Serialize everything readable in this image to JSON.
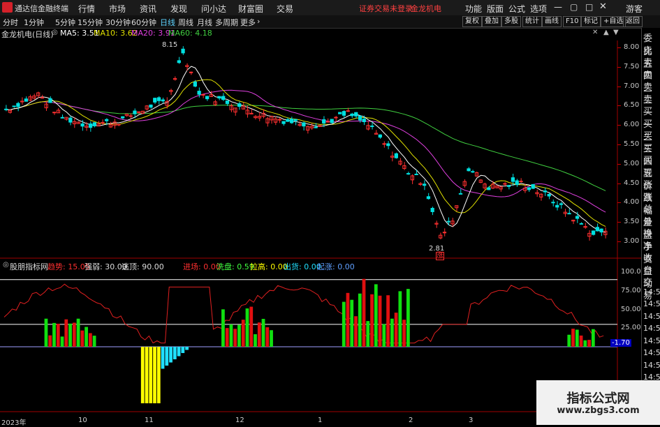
{
  "menubar": {
    "app_name": "通达信金融终端",
    "items": [
      "行情",
      "市场",
      "资讯",
      "发现",
      "问小达",
      "财富圈",
      "交易"
    ],
    "warning": "证券交易未登录",
    "stock": "金龙机电",
    "right_items": [
      "功能",
      "版面",
      "公式",
      "选项"
    ],
    "guest": "游客"
  },
  "toolbar": {
    "periods": [
      "分时",
      "1分钟",
      "5分钟",
      "15分钟",
      "30分钟",
      "60分钟",
      "日线",
      "周线",
      "月线",
      "多周期",
      "更多"
    ],
    "active": "日线",
    "right_buttons": [
      "复权",
      "叠加",
      "多股",
      "统计",
      "画线",
      "F10",
      "标记",
      "+自选",
      "返回"
    ]
  },
  "main_info": {
    "title": "金龙机电(日线)",
    "ma5": "MA5: 3.51",
    "ma10": "MA10: 3.62",
    "ma20": "MA20: 3.91",
    "ma60": "MA60: 4.18",
    "high_label": "8.15",
    "low_label": "2.81",
    "zhang": "涨"
  },
  "price_axis": [
    "8.00",
    "7.50",
    "7.00",
    "6.50",
    "6.00",
    "5.50",
    "5.00",
    "4.50",
    "4.00",
    "3.50",
    "3.00"
  ],
  "indicator": {
    "name": "股朋指标网",
    "trend": "趋势: 15.05",
    "strength": "强弱: 30.00",
    "escape": "逃顶: 90.00",
    "enter": "进场: 0.00",
    "wash": "洗盘: 0.59",
    "pull": "拉高: 0.00",
    "out": "出货: 0.00",
    "rise": "起涨: 0.00",
    "axis": [
      "100.0",
      "75.00",
      "50.00",
      "25.00"
    ],
    "current": "-1.70"
  },
  "right_panel": [
    "委比",
    "卖五",
    "卖四",
    "卖三",
    "卖二",
    "卖一",
    "买一",
    "买二",
    "买三",
    "买四",
    "买五",
    "现价",
    "涨跌",
    "涨幅",
    "总量",
    "外盘",
    "换手",
    "净资",
    "收益",
    "自动",
    "交易",
    "14:56",
    "14:56",
    "14:56",
    "14:56",
    "14:56",
    "14:56",
    "14:56",
    "14:56"
  ],
  "x_axis": [
    "2023年",
    "10",
    "11",
    "12",
    "1",
    "2",
    "3"
  ],
  "watermark": {
    "line1": "指标公式网",
    "line2": "www.zbgs3.com"
  },
  "colors": {
    "up": "#ff3030",
    "down": "#00e0e0",
    "ma5": "#ffffff",
    "ma10": "#e0e000",
    "ma20": "#e040e0",
    "ma60": "#40d040",
    "bar_red": "#e01010",
    "bar_green": "#10e010",
    "bar_yellow": "#ffff00",
    "bar_cyan": "#20e0ff"
  }
}
